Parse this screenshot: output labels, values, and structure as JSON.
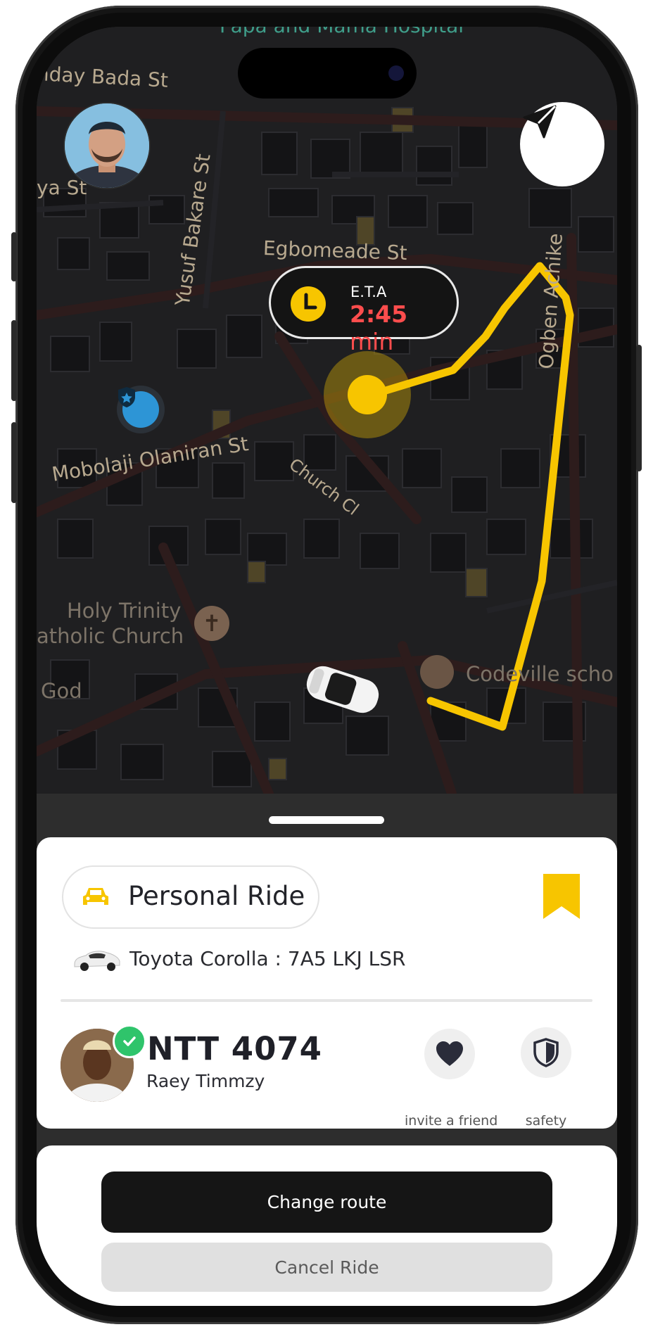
{
  "map": {
    "streets": {
      "top_left": "nday Bada St",
      "left_ya": "ya St",
      "yusuf": "Yusuf Bakare St",
      "egbomeade": "Egbomeade St",
      "achike": "Ogben Achike",
      "mobolaji": "Mobolaji Olaniran St",
      "church_cl": "Church Cl"
    },
    "places": {
      "hospital": "Papa and Mama Hospital",
      "church_line1": "Holy Trinity",
      "church_line2": "atholic Church",
      "god": "God",
      "school": "Codeville scho"
    },
    "icons": {
      "user_avatar": "user-avatar",
      "navigation": "navigation-arrow-icon",
      "police": "police-station-icon",
      "church": "church-icon",
      "school": "school-icon",
      "car": "car-icon"
    }
  },
  "eta": {
    "label": "E.T.A",
    "time": "2:45",
    "unit": "min"
  },
  "ride": {
    "type_label": "Personal Ride",
    "vehicle": "Toyota Corolla : 7A5 LKJ LSR"
  },
  "driver": {
    "plate": "NTT 4074",
    "name": "Raey Timmzy"
  },
  "quick_actions": {
    "invite": "invite a friend",
    "safety": "safety"
  },
  "buttons": {
    "change_route": "Change route",
    "cancel_ride": "Cancel Ride"
  },
  "colors": {
    "accent": "#F7C500",
    "eta_time": "#FF4D4D",
    "verified": "#2FC46B",
    "police": "#2D95D6"
  }
}
